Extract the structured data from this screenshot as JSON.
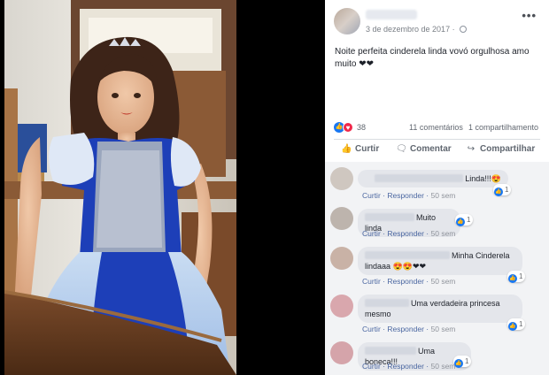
{
  "post": {
    "date": "3 de dezembro de 2017",
    "text": "Noite perfeita cinderela linda vovó orgulhosa amo muito ❤❤",
    "reaction_count": "38",
    "comments_count": "11 comentários",
    "shares_count": "1 compartilhamento"
  },
  "actions": {
    "like": "Curtir",
    "comment": "Comentar",
    "share": "Compartilhar"
  },
  "comments": [
    {
      "text": "Linda!!!😍",
      "reply": "Responder",
      "like": "Curtir",
      "time": "50 sem",
      "likes": "1"
    },
    {
      "text": "Muito linda",
      "reply": "Responder",
      "like": "Curtir",
      "time": "50 sem",
      "likes": "1"
    },
    {
      "text": "Minha Cinderela lindaaa 😍😍❤❤",
      "reply": "Responder",
      "like": "Curtir",
      "time": "50 sem",
      "likes": "1"
    },
    {
      "text": "Uma verdadeira princesa mesmo",
      "reply": "Responder",
      "like": "Curtir",
      "time": "50 sem",
      "likes": "1"
    },
    {
      "text": "Uma boneca!!!",
      "reply": "Responder",
      "like": "Curtir",
      "time": "50 sem",
      "likes": "1"
    }
  ],
  "colors": {
    "accent": "#1877f2",
    "love": "#f0284a",
    "link": "#4b67a1",
    "dress_blue": "#1d3fb8"
  },
  "icons": {
    "more": "more-dots-icon",
    "globe": "globe-icon",
    "like": "thumbs-up-icon",
    "comment": "comment-icon",
    "share": "share-icon"
  }
}
